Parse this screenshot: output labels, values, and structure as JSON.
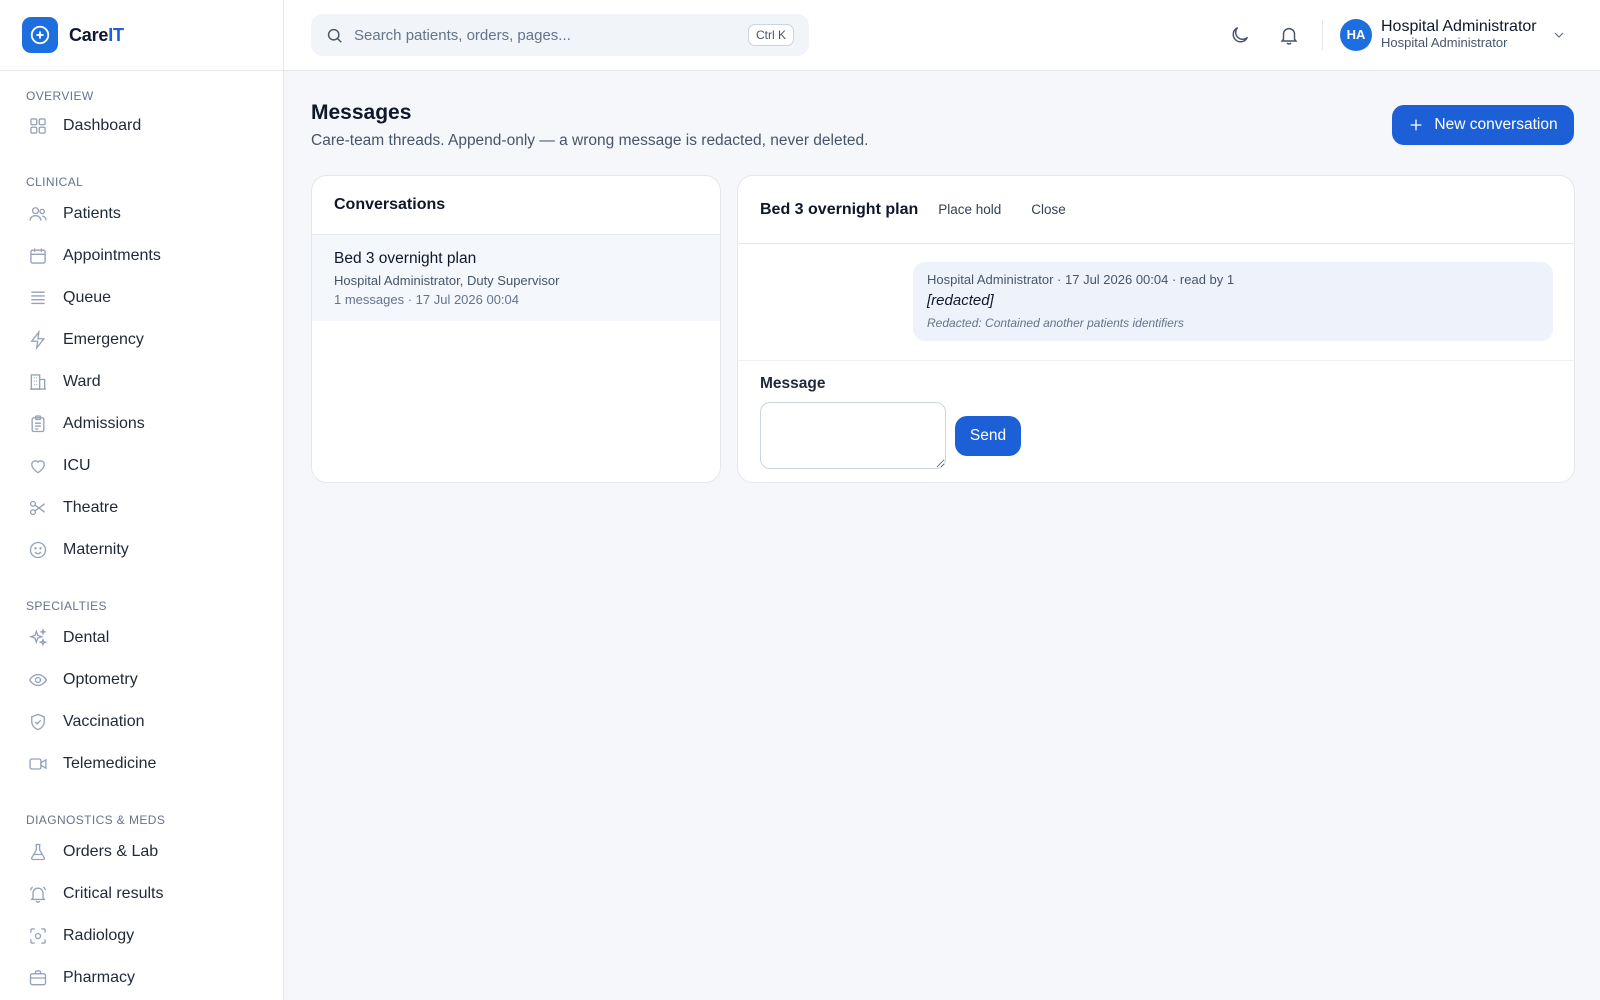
{
  "app": {
    "name_main": "Care",
    "name_accent": "IT"
  },
  "sidebar": {
    "sections": [
      {
        "title": "OVERVIEW",
        "items": [
          {
            "label": "Dashboard",
            "icon": "grid-icon"
          }
        ]
      },
      {
        "title": "CLINICAL",
        "items": [
          {
            "label": "Patients",
            "icon": "users-icon"
          },
          {
            "label": "Appointments",
            "icon": "calendar-icon"
          },
          {
            "label": "Queue",
            "icon": "list-icon"
          },
          {
            "label": "Emergency",
            "icon": "bolt-icon"
          },
          {
            "label": "Ward",
            "icon": "building-icon"
          },
          {
            "label": "Admissions",
            "icon": "clipboard-icon"
          },
          {
            "label": "ICU",
            "icon": "heart-icon"
          },
          {
            "label": "Theatre",
            "icon": "scissors-icon"
          },
          {
            "label": "Maternity",
            "icon": "smile-icon"
          }
        ]
      },
      {
        "title": "SPECIALTIES",
        "items": [
          {
            "label": "Dental",
            "icon": "sparkles-icon"
          },
          {
            "label": "Optometry",
            "icon": "eye-icon"
          },
          {
            "label": "Vaccination",
            "icon": "shield-check-icon"
          },
          {
            "label": "Telemedicine",
            "icon": "video-icon"
          }
        ]
      },
      {
        "title": "DIAGNOSTICS & MEDS",
        "items": [
          {
            "label": "Orders & Lab",
            "icon": "flask-icon"
          },
          {
            "label": "Critical results",
            "icon": "bell-ring-icon"
          },
          {
            "label": "Radiology",
            "icon": "scan-icon"
          },
          {
            "label": "Pharmacy",
            "icon": "briefcase-icon"
          }
        ]
      }
    ]
  },
  "topbar": {
    "search_placeholder": "Search patients, orders, pages...",
    "search_shortcut": "Ctrl K",
    "user": {
      "initials": "HA",
      "name": "Hospital Administrator",
      "role": "Hospital Administrator"
    }
  },
  "page": {
    "title": "Messages",
    "subtitle": "Care-team threads. Append-only — a wrong message is redacted, never deleted.",
    "new_button": "New conversation"
  },
  "conversations": {
    "header": "Conversations",
    "items": [
      {
        "title": "Bed 3 overnight plan",
        "participants": "Hospital Administrator, Duty Supervisor",
        "meta": "1 messages · 17 Jul 2026 00:04"
      }
    ]
  },
  "thread": {
    "title": "Bed 3 overnight plan",
    "actions": {
      "hold": "Place hold",
      "close": "Close"
    },
    "messages": [
      {
        "meta": "Hospital Administrator · 17 Jul 2026 00:04 · read by 1",
        "body": "[redacted]",
        "note": "Redacted: Contained another patients identifiers"
      }
    ],
    "composer": {
      "label": "Message",
      "value": "",
      "send": "Send"
    }
  },
  "colors": {
    "primary": "#1d5fd6",
    "accent": "#1d6fe0"
  }
}
